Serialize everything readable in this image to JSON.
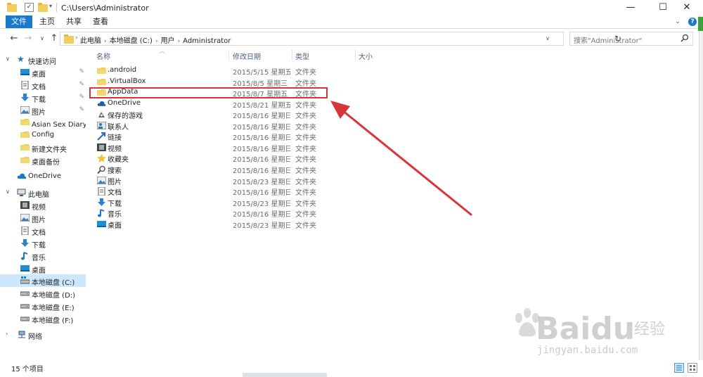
{
  "window": {
    "title_path": "C:\\Users\\Administrator",
    "minimize": "—",
    "maximize": "☐",
    "close": "✕"
  },
  "ribbon": {
    "tabs": [
      "文件",
      "主页",
      "共享",
      "查看"
    ],
    "expand": "⌄",
    "help": "?"
  },
  "address": {
    "crumbs": [
      "此电脑",
      "本地磁盘 (C:)",
      "用户",
      "Administrator"
    ],
    "search_placeholder": "搜索\"Administrator\""
  },
  "nav": {
    "quick_access": "快速访问",
    "quick_items": [
      {
        "label": "桌面",
        "icon": "desktop-icon",
        "pinned": true
      },
      {
        "label": "文档",
        "icon": "documents-icon",
        "pinned": true
      },
      {
        "label": "下载",
        "icon": "download-icon",
        "pinned": true
      },
      {
        "label": "图片",
        "icon": "pictures-icon",
        "pinned": true
      },
      {
        "label": "Asian Sex Diary 中国",
        "icon": "folder-icon",
        "pinned": false
      },
      {
        "label": "Config",
        "icon": "folder-icon",
        "pinned": false
      },
      {
        "label": "新建文件夹",
        "icon": "folder-icon",
        "pinned": false
      },
      {
        "label": "桌面备份",
        "icon": "folder-icon",
        "pinned": false
      }
    ],
    "onedrive": "OneDrive",
    "this_pc": "此电脑",
    "pc_items": [
      {
        "label": "视频",
        "icon": "videos-icon"
      },
      {
        "label": "图片",
        "icon": "pictures-icon"
      },
      {
        "label": "文档",
        "icon": "documents-icon"
      },
      {
        "label": "下载",
        "icon": "download-icon"
      },
      {
        "label": "音乐",
        "icon": "music-icon"
      },
      {
        "label": "桌面",
        "icon": "desktop-icon"
      },
      {
        "label": "本地磁盘 (C:)",
        "icon": "drive-c-icon",
        "selected": true
      },
      {
        "label": "本地磁盘 (D:)",
        "icon": "drive-icon"
      },
      {
        "label": "本地磁盘 (E:)",
        "icon": "drive-icon"
      },
      {
        "label": "本地磁盘 (F:)",
        "icon": "drive-icon"
      }
    ],
    "network": "网络"
  },
  "columns": [
    "名称",
    "修改日期",
    "类型",
    "大小"
  ],
  "files": [
    {
      "name": ".android",
      "date": "2015/5/15 星期五 ...",
      "type": "文件夹",
      "icon": "folder-icon"
    },
    {
      "name": ".VirtualBox",
      "date": "2015/8/5 星期三 ...",
      "type": "文件夹",
      "icon": "folder-icon"
    },
    {
      "name": "AppData",
      "date": "2015/8/7 星期五 ...",
      "type": "文件夹",
      "icon": "folder-icon"
    },
    {
      "name": "OneDrive",
      "date": "2015/8/21 星期五 ...",
      "type": "文件夹",
      "icon": "onedrive-icon"
    },
    {
      "name": "保存的游戏",
      "date": "2015/8/16 星期日 ...",
      "type": "文件夹",
      "icon": "saved-games-icon"
    },
    {
      "name": "联系人",
      "date": "2015/8/16 星期日 ...",
      "type": "文件夹",
      "icon": "contacts-icon"
    },
    {
      "name": "链接",
      "date": "2015/8/16 星期日 ...",
      "type": "文件夹",
      "icon": "links-icon"
    },
    {
      "name": "视频",
      "date": "2015/8/16 星期日 ...",
      "type": "文件夹",
      "icon": "videos-icon"
    },
    {
      "name": "收藏夹",
      "date": "2015/8/16 星期日 ...",
      "type": "文件夹",
      "icon": "favorites-icon"
    },
    {
      "name": "搜索",
      "date": "2015/8/16 星期日 ...",
      "type": "文件夹",
      "icon": "searches-icon"
    },
    {
      "name": "图片",
      "date": "2015/8/23 星期日 ...",
      "type": "文件夹",
      "icon": "pictures-icon"
    },
    {
      "name": "文档",
      "date": "2015/8/16 星期日 ...",
      "type": "文件夹",
      "icon": "documents-icon"
    },
    {
      "name": "下载",
      "date": "2015/8/23 星期日 ...",
      "type": "文件夹",
      "icon": "download-icon"
    },
    {
      "name": "音乐",
      "date": "2015/8/16 星期日 ...",
      "type": "文件夹",
      "icon": "music-icon"
    },
    {
      "name": "桌面",
      "date": "2015/8/23 星期日 ...",
      "type": "文件夹",
      "icon": "desktop-icon"
    }
  ],
  "status": {
    "item_count": "15 个项目"
  },
  "watermark": {
    "brand": "Bai",
    "brand2": "du",
    "sub": "经验",
    "url": "jingyan.baidu.com"
  },
  "colors": {
    "accent": "#1979ca",
    "highlight": "#d8353b",
    "selected": "#cce8ff"
  }
}
